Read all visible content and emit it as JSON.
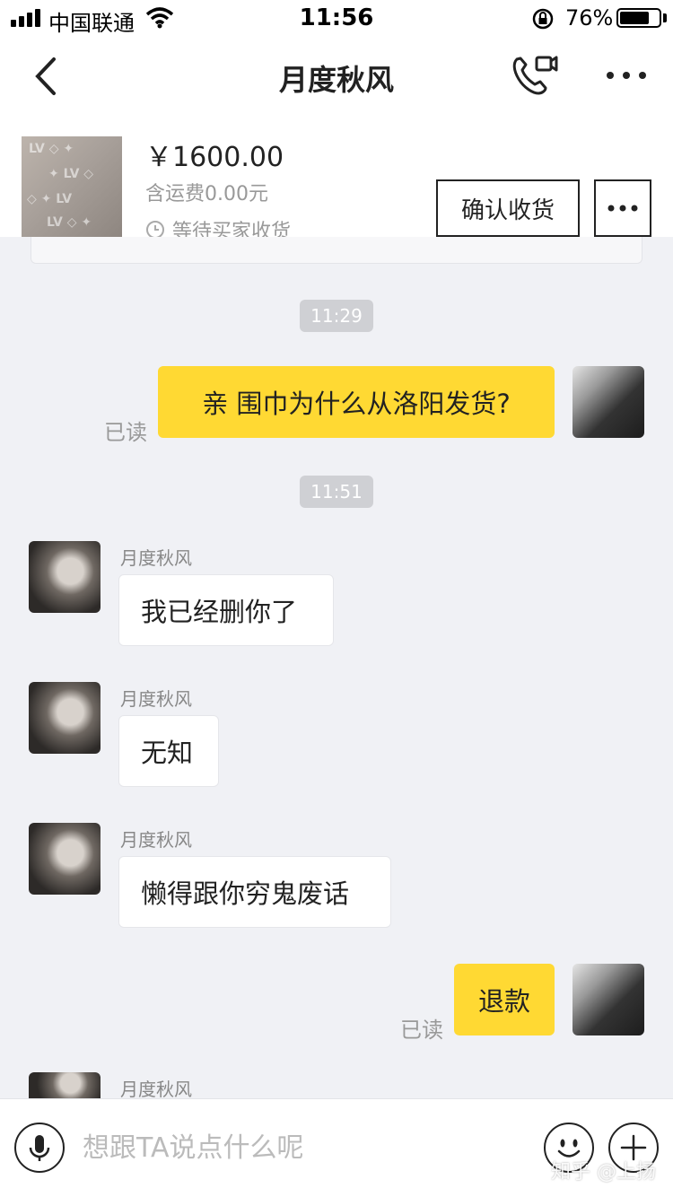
{
  "status_bar": {
    "carrier": "中国联通",
    "time": "11:56",
    "battery_percent": "76%",
    "battery_level": 0.76
  },
  "header": {
    "title": "月度秋风",
    "back_icon": "chevron-left-icon",
    "call_icon": "phone-video-icon",
    "more_icon": "more-icon"
  },
  "product": {
    "price": "￥1600.00",
    "shipping": "含运费0.00元",
    "status": "等待买家收货",
    "confirm_label": "确认收货"
  },
  "chat": {
    "timestamps": [
      "11:29",
      "11:51"
    ],
    "read_label": "已读",
    "messages": [
      {
        "from": "self",
        "text": "亲 围巾为什么从洛阳发货?",
        "read": "已读"
      },
      {
        "from": "peer",
        "sender": "月度秋风",
        "text": "我已经删你了"
      },
      {
        "from": "peer",
        "sender": "月度秋风",
        "text": "无知"
      },
      {
        "from": "peer",
        "sender": "月度秋风",
        "text": "懒得跟你穷鬼废话"
      },
      {
        "from": "self",
        "text": "退款",
        "read": "已读"
      },
      {
        "from": "peer",
        "sender": "月度秋风"
      }
    ]
  },
  "input_bar": {
    "placeholder": "想跟TA说点什么呢",
    "value": ""
  },
  "watermark": "知乎 @上扬",
  "colors": {
    "accent_yellow": "#ffd933",
    "background": "#f0f1f5"
  }
}
